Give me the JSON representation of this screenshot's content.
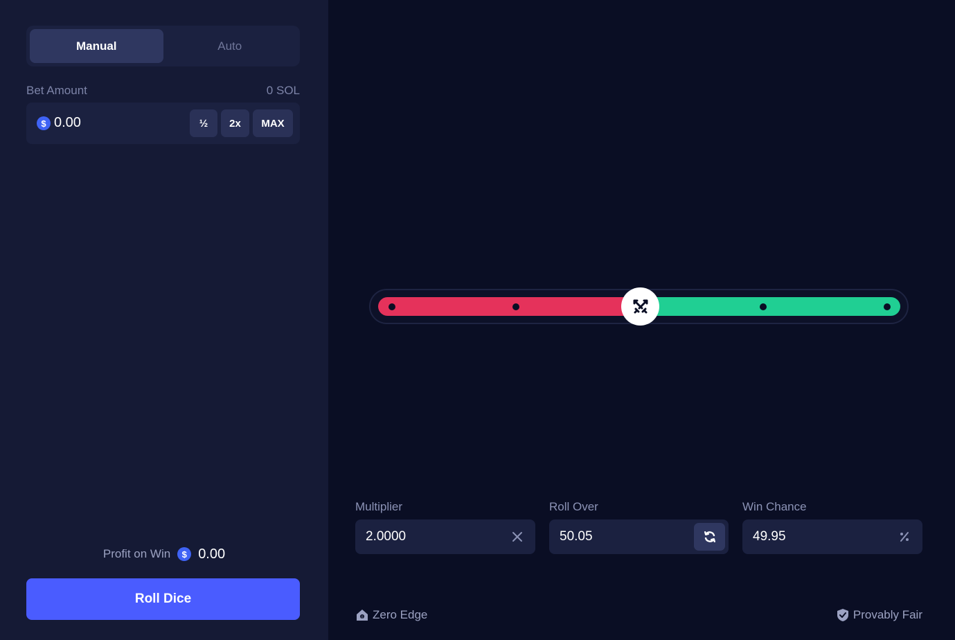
{
  "mode_tabs": [
    {
      "label": "Manual",
      "active": true
    },
    {
      "label": "Auto",
      "active": false
    }
  ],
  "bet": {
    "label": "Bet Amount",
    "balance": "0 SOL",
    "coin_symbol": "$",
    "value": "0.00",
    "buttons": {
      "half": "½",
      "double": "2x",
      "max": "MAX"
    }
  },
  "profit": {
    "label": "Profit on Win",
    "coin_symbol": "$",
    "value": "0.00"
  },
  "roll_button": "Roll Dice",
  "slider": {
    "value_fraction": 0.5005,
    "lose_color": "#e5325b",
    "win_color": "#20cf93",
    "handle_icon": "crossed-swords-icon"
  },
  "params": {
    "multiplier": {
      "label": "Multiplier",
      "value": "2.0000",
      "icon": "close-icon"
    },
    "roll_over": {
      "label": "Roll Over",
      "value": "50.05",
      "icon": "refresh-icon"
    },
    "win_chance": {
      "label": "Win Chance",
      "value": "49.95",
      "icon": "percent-icon"
    }
  },
  "footer": {
    "zero_edge": "Zero Edge",
    "provably_fair": "Provably Fair"
  },
  "colors": {
    "accent": "#4a5cff",
    "background": "#0a0e24",
    "sidebar": "#151a35"
  }
}
